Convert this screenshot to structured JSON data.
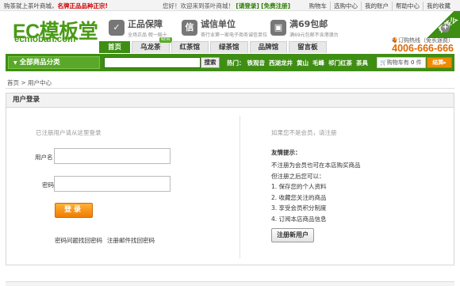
{
  "topbar": {
    "welcome_prefix": "购茶就上茶叶商城，",
    "welcome_bold": "名牌正品品种正宗!",
    "greet_text": "您好！欢迎来到茶叶商城！",
    "login_link": "[请登录]",
    "register_link": "[免费注册]",
    "links": [
      "购物车",
      "选购中心",
      "我的账户",
      "帮助中心",
      "我的收藏"
    ]
  },
  "brand": {
    "logo_text": "EC模板堂",
    "logo_domain": "ecmoban.com",
    "colors": {
      "brand_green": "#3f8e14",
      "logo_green": "#4a9a16",
      "accent_orange": "#f07c00"
    }
  },
  "promos": [
    {
      "icon": "shield-icon",
      "title": "正品保障",
      "sub": "全场正品 假一赔十",
      "sub_red": ""
    },
    {
      "icon": "certificate-icon",
      "title": "诚信单位",
      "sub": "茶行业第一家电子商务诚信单位",
      "sub_red": ""
    },
    {
      "icon": "truck-icon",
      "title": "满69包邮",
      "sub": "满69元包邮不含港澳台",
      "sub_red": ""
    }
  ],
  "corner_badge": "最茶么",
  "hotline": {
    "label": "订购热线（免长途费）",
    "number": "4006-666-666"
  },
  "nav": {
    "tabs": [
      {
        "label": "首页",
        "badge": ""
      },
      {
        "label": "乌龙茶",
        "badge": "NEW"
      },
      {
        "label": "红茶馆",
        "badge": "HOT"
      },
      {
        "label": "绿茶馆",
        "badge": ""
      },
      {
        "label": "品牌馆",
        "badge": ""
      },
      {
        "label": "留言板",
        "badge": ""
      }
    ],
    "active_index": 0
  },
  "search": {
    "category_button": "全部商品分类",
    "search_button": "搜索",
    "placeholder": "",
    "hot_label": "热门：",
    "hot_keywords": [
      "铁观音",
      "西湖龙井",
      "黄山",
      "毛峰",
      "祁门红茶",
      "茶具"
    ]
  },
  "cart": {
    "label": "购物车有",
    "count": "0",
    "unit": "件",
    "checkout": "结算"
  },
  "breadcrumb": "首页  > 用户中心",
  "panel": {
    "title": "用户登录",
    "login": {
      "hint": "已注册用户请从这里登录",
      "username_label": "用户名",
      "password_label": "密码",
      "username_value": "",
      "password_value": "",
      "login_button": "登录",
      "forgot_question": "密码问题找回密码",
      "forgot_email": "注册邮件找回密码"
    },
    "register": {
      "hint": "如果您不是会员，请注册",
      "tips_title": "友情提示：",
      "tips": [
        "不注册为会员也可在本店购买商品",
        "但注册之后您可以：",
        "1. 保存您的个人资料",
        "2. 收藏您关注的商品",
        "3. 享受会员积分制度",
        "4. 订阅本店商品信息"
      ],
      "register_button": "注册新用户"
    }
  }
}
